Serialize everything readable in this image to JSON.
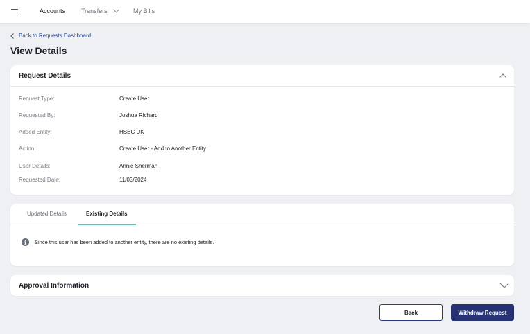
{
  "nav": {
    "menu_icon": "hamburger-icon",
    "items": [
      {
        "label": "Accounts",
        "active": true
      },
      {
        "label": "Transfers",
        "has_dropdown": true
      },
      {
        "label": "My Bills"
      }
    ]
  },
  "breadcrumb": {
    "back_label": "Back to Requests Dashboard"
  },
  "page": {
    "title": "View Details"
  },
  "request_details": {
    "title": "Request Details",
    "expanded": true,
    "rows": [
      {
        "label": "Request Type:",
        "value": "Create User"
      },
      {
        "label": "Requested By:",
        "value": "Joshua Richard"
      },
      {
        "label": "Added Entity:",
        "value": "HSBC UK"
      },
      {
        "label": "Action:",
        "value": "Create User - Add to Another Entity"
      },
      {
        "label": "User Details:",
        "value": "Annie Sherman"
      },
      {
        "label": "Requested Date:",
        "value": "11/03/2024"
      }
    ]
  },
  "details_tabs": {
    "tabs": [
      {
        "label": "Updated Details",
        "active": false
      },
      {
        "label": "Existing Details",
        "active": true
      }
    ],
    "message": "Since this user has been added to another entity, there are no existing details."
  },
  "approval": {
    "title": "Approval Information",
    "expanded": false
  },
  "actions": {
    "back_label": "Back",
    "withdraw_label": "Withdraw Request"
  },
  "colors": {
    "background": "#eef0f3",
    "primary": "#273272",
    "link": "#2b4a9a",
    "tab_accent": "#5ac8b1"
  }
}
